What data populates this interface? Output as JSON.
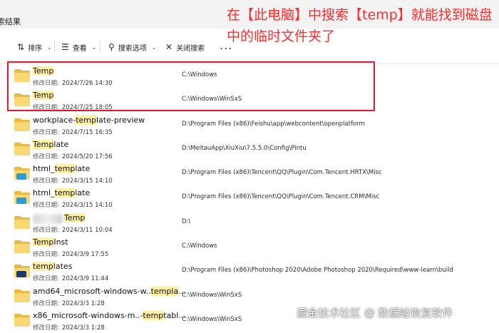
{
  "window": {
    "title": "索结果"
  },
  "toolbar": {
    "sort_label": "排序",
    "view_label": "查看",
    "search_options_label": "搜索选项",
    "close_search_label": "关闭搜索",
    "more_label": "..."
  },
  "annotation": {
    "text": "在【此电脑】中搜索【temp】就能找到磁盘中的临时文件夹了",
    "color": "#ff2a2a"
  },
  "date_label": "修改日期:",
  "results": [
    {
      "name_parts": [
        {
          "t": "Temp",
          "hl": true
        }
      ],
      "date": "2024/7/26 14:30",
      "path": "C:\\Windows",
      "badge": null
    },
    {
      "name_parts": [
        {
          "t": "Temp",
          "hl": true
        }
      ],
      "date": "2024/7/25 18:05",
      "path": "C:\\Windows\\WinSxS",
      "badge": null
    },
    {
      "name_parts": [
        {
          "t": "workplace-",
          "hl": false
        },
        {
          "t": "temp",
          "hl": true
        },
        {
          "t": "late-preview",
          "hl": false
        }
      ],
      "date": "2024/7/15 16:35",
      "path": "D:\\Program Files (x86)\\Feishu\\app\\webcontent\\openplatform",
      "badge": null
    },
    {
      "name_parts": [
        {
          "t": "Temp",
          "hl": true
        },
        {
          "t": "late",
          "hl": false
        }
      ],
      "date": "2024/5/20 17:56",
      "path": "D:\\MeitauApp\\XiuXiu\\7.5.5.0\\Config\\Pintu",
      "badge": null
    },
    {
      "name_parts": [
        {
          "t": "html_",
          "hl": false
        },
        {
          "t": "temp",
          "hl": true
        },
        {
          "t": "late",
          "hl": false
        }
      ],
      "date": "2024/3/15 14:10",
      "path": "D:\\Program Files (x86)\\Tencent\\QQ\\Plugin\\Com.Tencent.HRTX\\Misc",
      "badge": "#2a9bd6"
    },
    {
      "name_parts": [
        {
          "t": "html_",
          "hl": false
        },
        {
          "t": "temp",
          "hl": true
        },
        {
          "t": "late",
          "hl": false
        }
      ],
      "date": "2024/3/15 14:10",
      "path": "D:\\Program Files (x86)\\Tencent\\QQ\\Plugin\\Com.Tencent.CRM\\Misc",
      "badge": "#2a9bd6"
    },
    {
      "name_parts": [
        {
          "t": "Temp",
          "hl": true
        }
      ],
      "date": "2024/3/11 10:04",
      "path": "D:\\",
      "badge": null,
      "blurred_prefix": true
    },
    {
      "name_parts": [
        {
          "t": "Temp",
          "hl": true
        },
        {
          "t": "Inst",
          "hl": false
        }
      ],
      "date": "2024/3/9 17:55",
      "path": "C:\\Windows",
      "badge": null
    },
    {
      "name_parts": [
        {
          "t": "temp",
          "hl": true
        },
        {
          "t": "lates",
          "hl": false
        }
      ],
      "date": "2024/3/9 11:44",
      "path": "D:\\Program Files (x86)\\Photoshop 2020\\Adobe Photoshop 2020\\Required\\www-learn\\build",
      "badge": "#1f3b6b"
    },
    {
      "name_parts": [
        {
          "t": "amd64_microsoft-windows-w..",
          "hl": false
        },
        {
          "t": "templa",
          "hl": true
        },
        {
          "t": "...",
          "hl": false
        }
      ],
      "date": "2024/3/3 1:28",
      "path": "C:\\Windows\\WinSxS",
      "badge": null
    },
    {
      "name_parts": [
        {
          "t": "x86_microsoft-windows-m..-",
          "hl": false
        },
        {
          "t": "temp",
          "hl": true
        },
        {
          "t": "tabl...",
          "hl": false
        }
      ],
      "date": "2024/3/3 1:28",
      "path": "C:\\Windows\\WinSxS",
      "badge": null
    }
  ],
  "watermark": "掘金技术社区 @ 数据蛙恢复软件"
}
